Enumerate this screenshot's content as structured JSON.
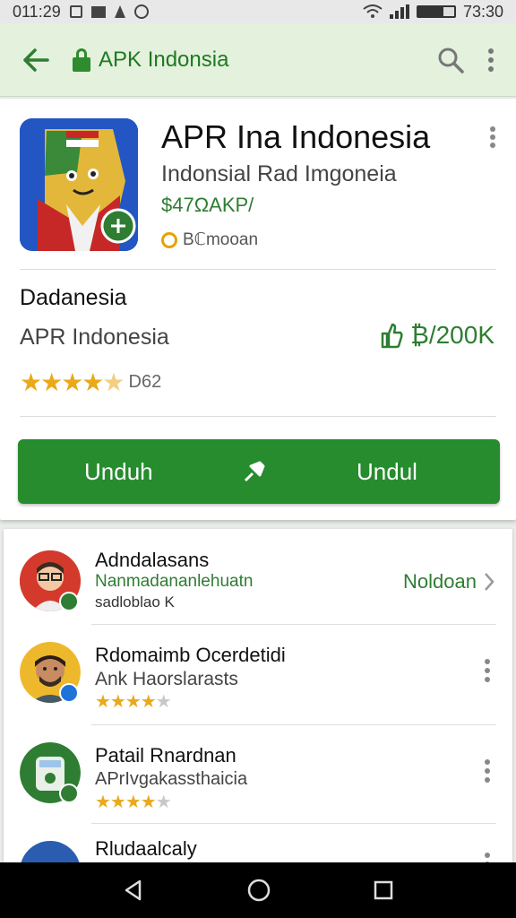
{
  "status_bar": {
    "time_left": "011:29",
    "time_right": "73:30",
    "battery_label": "▯▯▯▯"
  },
  "app_bar": {
    "title": "APK Indonsia",
    "icons": [
      "back-arrow-icon",
      "lock-icon",
      "search-icon",
      "more-vert-icon"
    ]
  },
  "app": {
    "title": "APR Ina Indonesia",
    "subtitle": "Indonsial Rad Imgoneia",
    "price": "$47ΩAKP/",
    "badge": "Bℂmooan",
    "section_title": "Dadanesia",
    "developer": "APR Indonesia",
    "downloads": "₿/200K",
    "rating": 4.5,
    "rating_count": "D62",
    "install_label": "Unduh",
    "install_label_2": "Undul"
  },
  "list": {
    "items": [
      {
        "name": "Adndalasans",
        "line2": "Nanmadananlehuatn",
        "line3": "sadloblao K",
        "action": "Noldoan",
        "rating": null,
        "accent": "#2e7d32"
      },
      {
        "name": "Rdomaimb Ocerdetidi",
        "line2": "Ank Haorslarasts",
        "line3": "",
        "action": "",
        "rating": 4,
        "accent": "#1e73d8"
      },
      {
        "name": "Patail Rnardnan",
        "line2": "APrIvgakassthaicia",
        "line3": "",
        "action": "",
        "rating": 4,
        "accent": "#2e7d32"
      },
      {
        "name": "Rludaalcaly",
        "line2": "",
        "line3": "",
        "action": "",
        "rating": null,
        "accent": "#2e7d32"
      }
    ]
  },
  "nav_bar": {
    "icons": [
      "back-triangle-icon",
      "home-circle-icon",
      "recents-square-icon"
    ]
  },
  "colors": {
    "primary_green": "#268c2e",
    "appbar_bg": "#e3f1dd",
    "star": "#e9a91b"
  }
}
